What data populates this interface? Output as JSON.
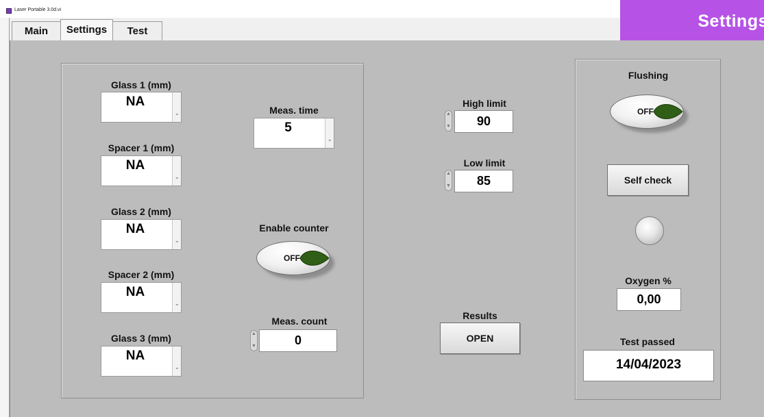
{
  "window": {
    "title": "Laser Portable 3.0d.vi"
  },
  "banner": {
    "title": "Settings"
  },
  "tabs": [
    {
      "label": "Main"
    },
    {
      "label": "Settings"
    },
    {
      "label": "Test"
    }
  ],
  "left_panel": {
    "glass1": {
      "label": "Glass 1 (mm)",
      "value": "NA"
    },
    "spacer1": {
      "label": "Spacer 1 (mm)",
      "value": "NA"
    },
    "glass2": {
      "label": "Glass 2 (mm)",
      "value": "NA"
    },
    "spacer2": {
      "label": "Spacer 2 (mm)",
      "value": "NA"
    },
    "glass3": {
      "label": "Glass 3 (mm)",
      "value": "NA"
    },
    "meas_time": {
      "label": "Meas. time",
      "value": "5"
    },
    "enable_counter": {
      "label": "Enable counter",
      "state": "OFF"
    },
    "meas_count": {
      "label": "Meas. count",
      "value": "0"
    }
  },
  "limits": {
    "high": {
      "label": "High limit",
      "value": "90"
    },
    "low": {
      "label": "Low limit",
      "value": "85"
    }
  },
  "results": {
    "label": "Results",
    "button": "OPEN"
  },
  "right_panel": {
    "flushing": {
      "label": "Flushing",
      "state": "OFF"
    },
    "self_check": "Self check",
    "oxygen": {
      "label": "Oxygen %",
      "value": "0,00"
    },
    "test_passed": {
      "label": "Test passed",
      "value": "14/04/2023"
    }
  },
  "colors": {
    "background": "#bcbcbc",
    "banner": "#b653e6",
    "toggle_tip": "#2f5e16"
  }
}
